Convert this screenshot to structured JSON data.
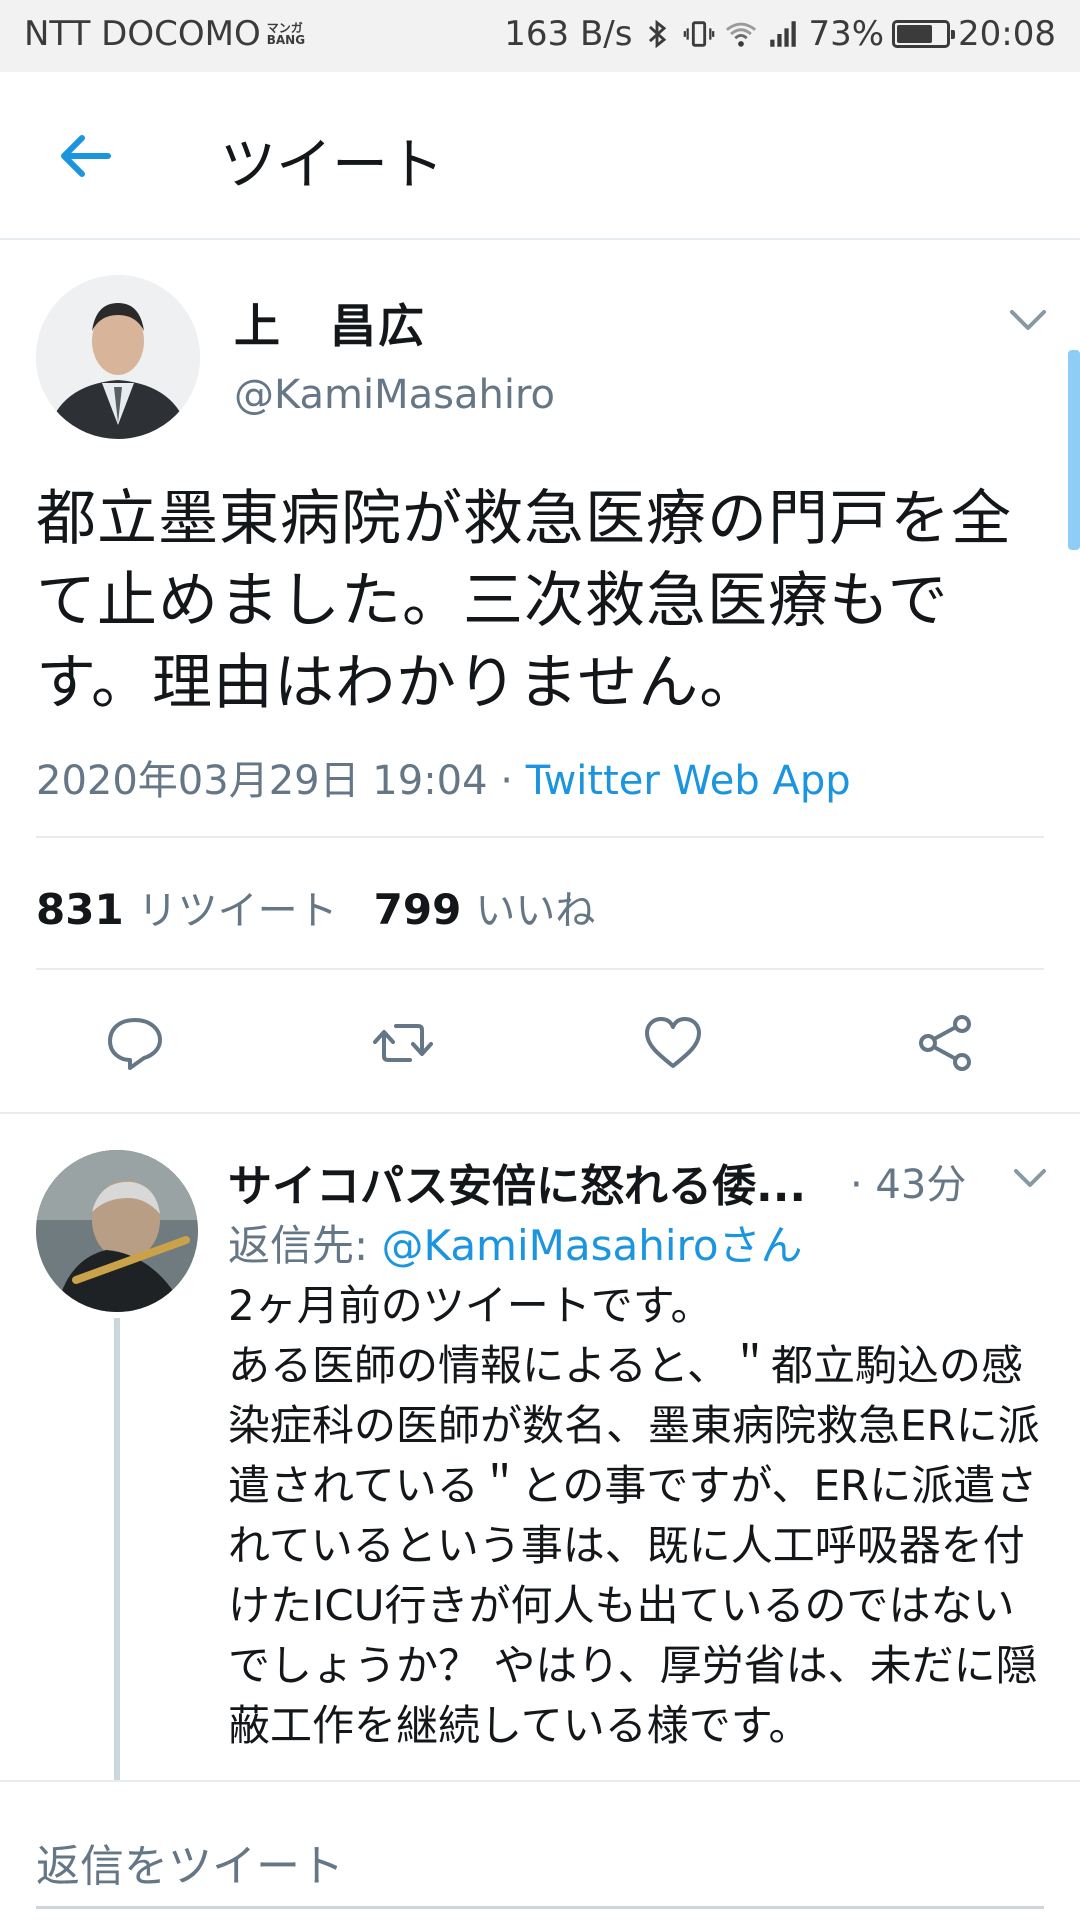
{
  "status_bar": {
    "carrier": "NTT DOCOMO",
    "carrier_tag": "マンガ BANG",
    "speed": "163 B/s",
    "battery": "73%",
    "battery_level": 0.73,
    "time": "20:08"
  },
  "header": {
    "title": "ツイート",
    "back_icon": "arrow-left-icon"
  },
  "tweet": {
    "author_name": "上　昌広",
    "author_handle": "@KamiMasahiro",
    "text": "都立墨東病院が救急医療の門戸を全て止めました。三次救急医療もです。理由はわかりません。",
    "date": "2020年03月29日 19:04",
    "separator": " · ",
    "source": "Twitter Web App",
    "retweets": "831",
    "retweets_label": "リツイート",
    "likes": "799",
    "likes_label": "いいね"
  },
  "actions": [
    {
      "name": "reply",
      "icon": "reply-icon"
    },
    {
      "name": "retweet",
      "icon": "retweet-icon"
    },
    {
      "name": "like",
      "icon": "heart-icon"
    },
    {
      "name": "share",
      "icon": "share-icon"
    }
  ],
  "reply": {
    "author_name": "サイコパス安倍に怒れる倭...",
    "time": "· 43分",
    "reply_to_label": "返信先: ",
    "reply_to_mention": "@KamiMasahiroさん",
    "body_line1": "2ヶ月前のツイートです。",
    "body_rest": "ある医師の情報によると、＂都立駒込の感染症科の医師が数名、墨東病院救急ERに派遣されている＂との事ですが、ERに派遣されているという事は、既に人工呼吸器を付けたICU行きが何人も出ているのではないでしょうか？ やはり、厚労省は、未だに隠蔽工作を継続している様です。"
  },
  "compose": {
    "placeholder": "返信をツイート"
  },
  "colors": {
    "accent": "#1b95e0",
    "secondary_text": "#657786",
    "divider": "#e6ecf0"
  }
}
